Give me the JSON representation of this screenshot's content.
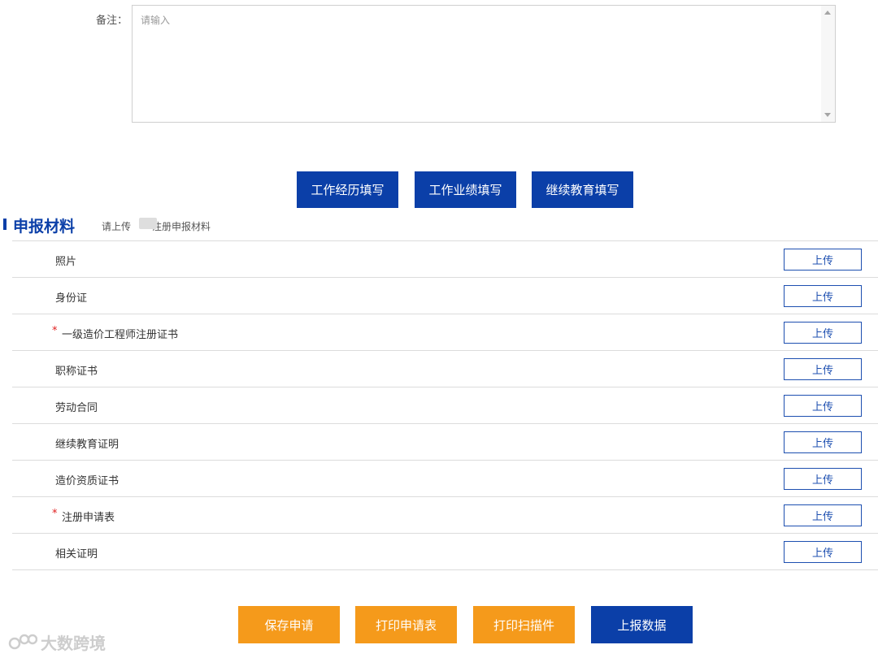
{
  "remark": {
    "label": "备注：",
    "placeholder": "请输入",
    "value": ""
  },
  "fill_buttons": [
    "工作经历填写",
    "工作业绩填写",
    "继续教育填写"
  ],
  "materials": {
    "title": "申报材料",
    "subtitle": "请上传",
    "subtitle_tail": "注册申报材料",
    "upload_label": "上传",
    "items": [
      {
        "label": "照片",
        "required": false
      },
      {
        "label": "身份证",
        "required": false
      },
      {
        "label": "一级造价工程师注册证书",
        "required": true
      },
      {
        "label": "职称证书",
        "required": false
      },
      {
        "label": "劳动合同",
        "required": false
      },
      {
        "label": "继续教育证明",
        "required": false
      },
      {
        "label": "造价资质证书",
        "required": false
      },
      {
        "label": "注册申请表",
        "required": true
      },
      {
        "label": "相关证明",
        "required": false
      }
    ]
  },
  "actions": {
    "save": "保存申请",
    "print_form": "打印申请表",
    "print_scan": "打印扫描件",
    "submit": "上报数据"
  },
  "watermark": {
    "text": "大数跨境"
  },
  "colors": {
    "primary": "#0b3fa8",
    "accent": "#f59a1b",
    "required": "#e02020"
  }
}
